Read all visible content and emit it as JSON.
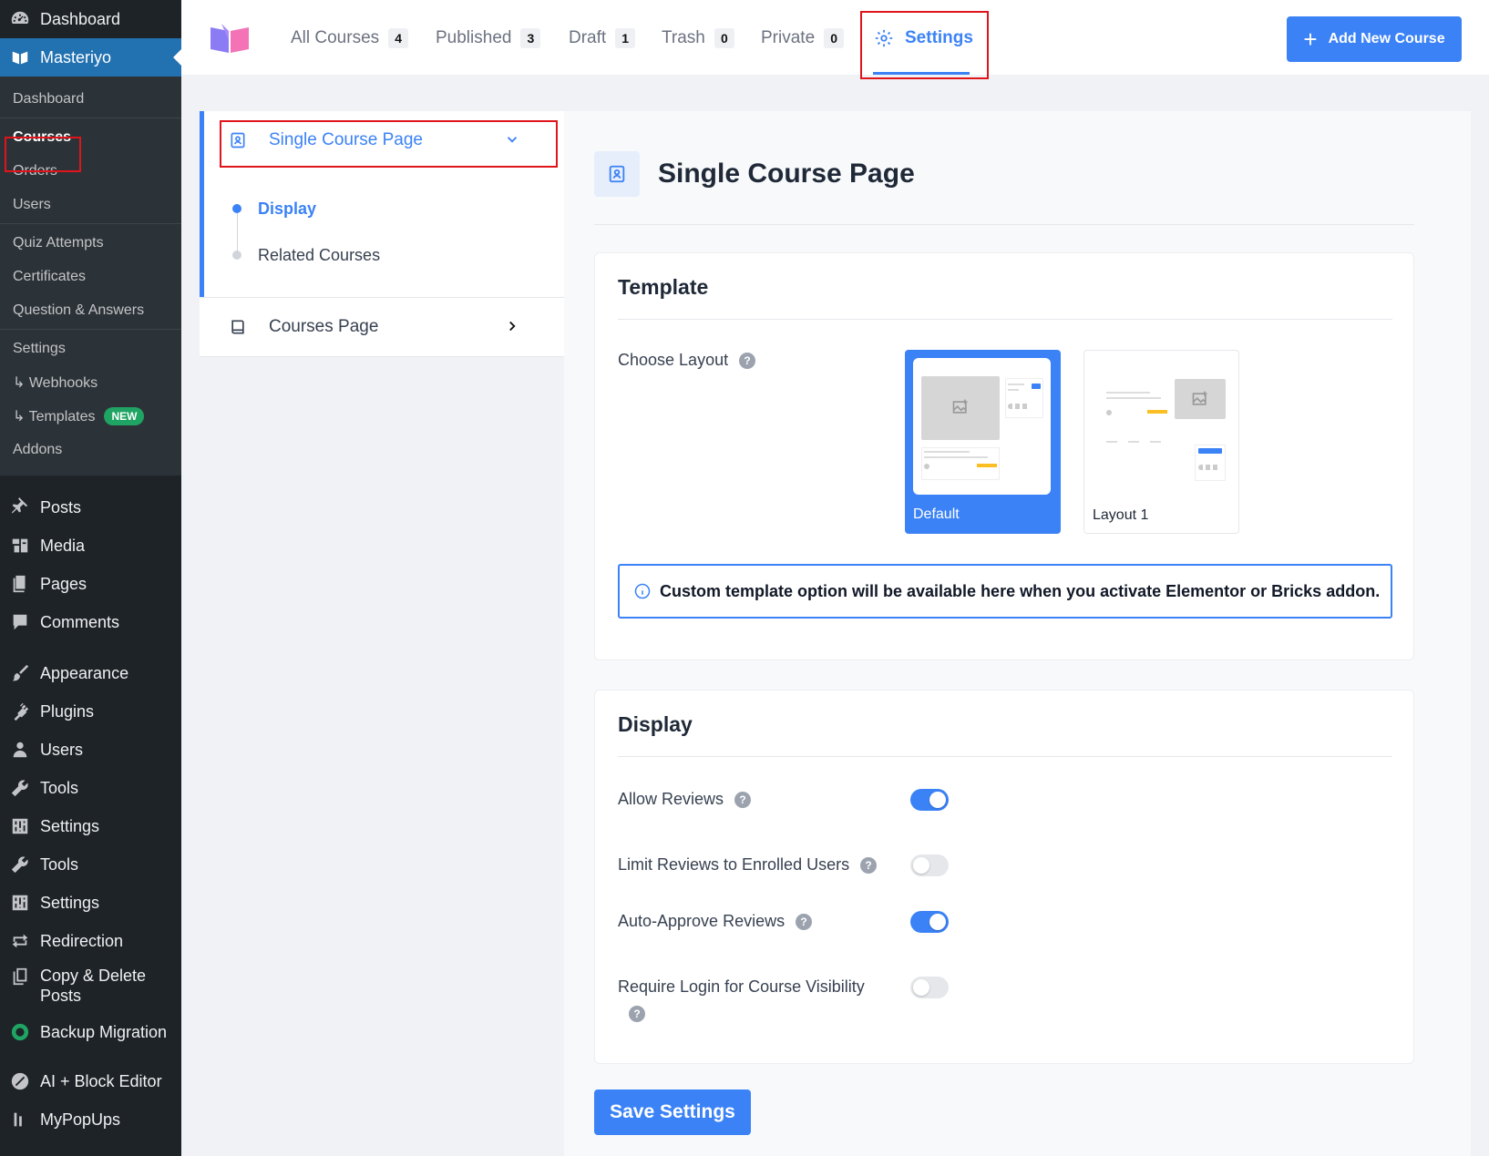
{
  "wp_sidebar": {
    "top_items": [
      {
        "label": "Dashboard",
        "icon": "dashboard-icon"
      },
      {
        "label": "Masteriyo",
        "icon": "masteriyo-icon",
        "active": true
      }
    ],
    "submenu": [
      "Dashboard",
      "Courses",
      "Orders",
      "Users",
      "Quiz Attempts",
      "Certificates",
      "Question & Answers",
      "Settings",
      "↳ Webhooks",
      "↳ Templates",
      "Addons"
    ],
    "submenu_current": "Courses",
    "new_badge": "NEW",
    "menu_items": [
      "Posts",
      "Media",
      "Pages",
      "Comments",
      "Appearance",
      "Plugins",
      "Users",
      "Tools",
      "Settings",
      "Tools",
      "Settings",
      "Redirection",
      "Copy & Delete Posts",
      "Backup Migration",
      "AI + Block Editor",
      "MyPopUps"
    ]
  },
  "topbar": {
    "tabs": [
      {
        "label": "All Courses",
        "count": "4"
      },
      {
        "label": "Published",
        "count": "3"
      },
      {
        "label": "Draft",
        "count": "1"
      },
      {
        "label": "Trash",
        "count": "0"
      },
      {
        "label": "Private",
        "count": "0"
      }
    ],
    "settings_tab": "Settings",
    "add_button": "Add New Course",
    "accent_color": "#3b82f6"
  },
  "settings_nav": {
    "groups": [
      {
        "label": "Single Course Page",
        "subitems": [
          "Display",
          "Related Courses"
        ],
        "active_sub": "Display"
      },
      {
        "label": "Courses Page"
      }
    ]
  },
  "main": {
    "page_title": "Single Course Page",
    "template": {
      "title": "Template",
      "choose_layout_label": "Choose Layout",
      "layouts": [
        {
          "label": "Default",
          "selected": true
        },
        {
          "label": "Layout 1",
          "selected": false
        }
      ],
      "notice": "Custom template option will be available here when you activate Elementor or Bricks addon."
    },
    "display": {
      "title": "Display",
      "settings": [
        {
          "label": "Allow Reviews",
          "enabled": true
        },
        {
          "label": "Limit Reviews to Enrolled Users",
          "enabled": false
        },
        {
          "label": "Auto-Approve Reviews",
          "enabled": true
        },
        {
          "label": "Require Login for Course Visibility",
          "enabled": false
        }
      ]
    },
    "save_button": "Save Settings"
  },
  "help_glyph": "?"
}
